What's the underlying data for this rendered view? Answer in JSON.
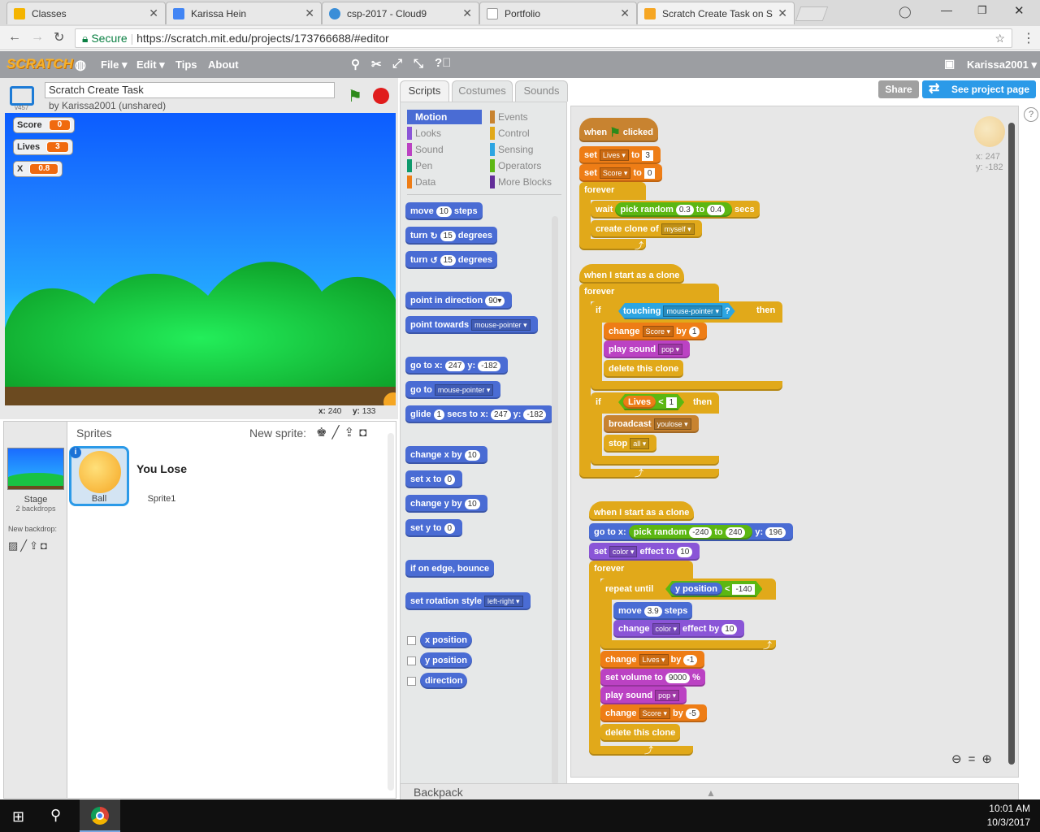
{
  "browser": {
    "tabs": [
      {
        "title": "Classes",
        "active": false
      },
      {
        "title": "Karissa Hein",
        "active": false
      },
      {
        "title": "csp-2017 - Cloud9",
        "active": false
      },
      {
        "title": "Portfolio",
        "active": false
      },
      {
        "title": "Scratch Create Task on Sc",
        "active": true
      }
    ],
    "secure_label": "Secure",
    "url": "https://scratch.mit.edu/projects/173766688/#editor"
  },
  "menubar": {
    "logo": "SCRATCH",
    "file": "File ▾",
    "edit": "Edit ▾",
    "tips": "Tips",
    "about": "About",
    "user": "Karissa2001 ▾"
  },
  "project": {
    "title": "Scratch Create Task",
    "author": "by Karissa2001 (unshared)",
    "version": "v457",
    "share": "Share",
    "see_page": "See project page"
  },
  "monitors": [
    {
      "label": "Score",
      "value": "0"
    },
    {
      "label": "Lives",
      "value": "3"
    },
    {
      "label": "X",
      "value": "0.8"
    }
  ],
  "stage_readout": {
    "x_label": "x:",
    "x": "240",
    "y_label": "y:",
    "y": "133"
  },
  "sprites": {
    "header": "Sprites",
    "new_sprite": "New sprite:",
    "stage_label": "Stage",
    "stage_backdrops": "2 backdrops",
    "new_backdrop": "New backdrop:",
    "items": [
      {
        "name": "Ball",
        "selected": true
      },
      {
        "name": "Sprite1",
        "thumb_text": "You Lose",
        "selected": false
      }
    ]
  },
  "panel_tabs": [
    "Scripts",
    "Costumes",
    "Sounds"
  ],
  "categories": [
    {
      "label": "Motion",
      "color": "#4a6cd4"
    },
    {
      "label": "Looks",
      "color": "#8a55d7"
    },
    {
      "label": "Sound",
      "color": "#bb42c3"
    },
    {
      "label": "Pen",
      "color": "#0e9a6c"
    },
    {
      "label": "Data",
      "color": "#ee7d16"
    },
    {
      "label": "Events",
      "color": "#c88330"
    },
    {
      "label": "Control",
      "color": "#e1a91a"
    },
    {
      "label": "Sensing",
      "color": "#2ca5e2"
    },
    {
      "label": "Operators",
      "color": "#5cb712"
    },
    {
      "label": "More Blocks",
      "color": "#632d99"
    }
  ],
  "palette_blocks": {
    "move": [
      "move",
      "10",
      "steps"
    ],
    "turn_cw": [
      "turn",
      "15",
      "degrees"
    ],
    "turn_ccw": [
      "turn",
      "15",
      "degrees"
    ],
    "point_dir": [
      "point in direction",
      "90▾"
    ],
    "point_towards": [
      "point towards",
      "mouse-pointer ▾"
    ],
    "goto_xy": [
      "go to x:",
      "247",
      "y:",
      "-182"
    ],
    "goto": [
      "go to",
      "mouse-pointer ▾"
    ],
    "glide": [
      "glide",
      "1",
      "secs to x:",
      "247",
      "y:",
      "-182"
    ],
    "change_x": [
      "change x by",
      "10"
    ],
    "set_x": [
      "set x to",
      "0"
    ],
    "change_y": [
      "change y by",
      "10"
    ],
    "set_y": [
      "set y to",
      "0"
    ],
    "bounce": "if on edge, bounce",
    "rot_style": [
      "set rotation style",
      "left-right ▾"
    ],
    "reporters": [
      "x position",
      "y position",
      "direction"
    ]
  },
  "sprite_info": {
    "x": "x: 247",
    "y": "y: -182"
  },
  "scripts": {
    "s1": {
      "hat": [
        "when",
        "clicked"
      ],
      "set_lives": [
        "set",
        "Lives ▾",
        "to",
        "3"
      ],
      "set_score": [
        "set",
        "Score ▾",
        "to",
        "0"
      ],
      "forever": "forever",
      "wait": [
        "wait",
        "pick random",
        "0.3",
        "to",
        "0.4",
        "secs"
      ],
      "clone": [
        "create clone of",
        "myself ▾"
      ]
    },
    "s2": {
      "hat": "when I start as a clone",
      "forever": "forever",
      "if1": [
        "if",
        "touching",
        "mouse-pointer ▾",
        "?",
        "then"
      ],
      "change_score": [
        "change",
        "Score ▾",
        "by",
        "1"
      ],
      "play_sound": [
        "play sound",
        "pop ▾"
      ],
      "delete": "delete this clone",
      "if2": [
        "if",
        "Lives",
        "<",
        "1",
        "then"
      ],
      "broadcast": [
        "broadcast",
        "youlose ▾"
      ],
      "stop": [
        "stop",
        "all ▾"
      ]
    },
    "s3": {
      "hat": "when I start as a clone",
      "goto": [
        "go to x:",
        "pick random",
        "-240",
        "to",
        "240",
        "y:",
        "196"
      ],
      "set_effect": [
        "set",
        "color ▾",
        "effect to",
        "10"
      ],
      "forever": "forever",
      "repeat": [
        "repeat until",
        "y position",
        "<",
        "-140"
      ],
      "move": [
        "move",
        "3.9",
        "steps"
      ],
      "change_effect": [
        "change",
        "color ▾",
        "effect by",
        "10"
      ],
      "change_lives": [
        "change",
        "Lives ▾",
        "by",
        "-1"
      ],
      "volume": [
        "set volume to",
        "9000",
        "%"
      ],
      "play_sound": [
        "play sound",
        "pop ▾"
      ],
      "change_score": [
        "change",
        "Score ▾",
        "by",
        "-5"
      ],
      "delete": "delete this clone"
    }
  },
  "backpack": "Backpack",
  "taskbar": {
    "time": "10:01 AM",
    "date": "10/3/2017"
  }
}
